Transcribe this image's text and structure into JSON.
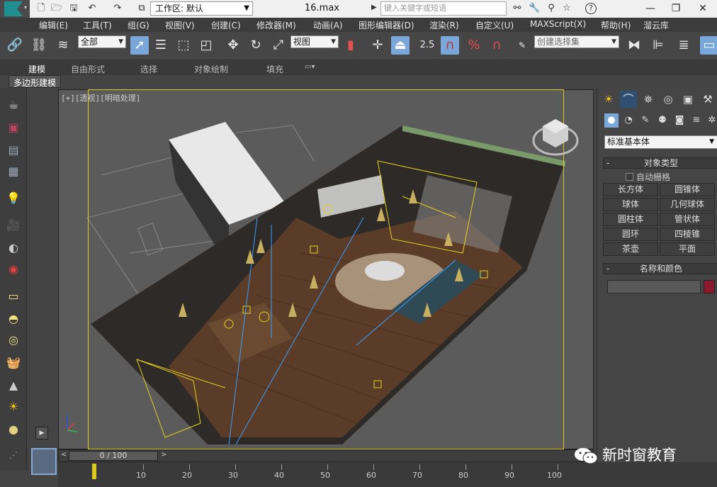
{
  "title_bar": {
    "workspace_label": "工作区: 默认",
    "file_name": "16.max",
    "search_placeholder": "键入关键字或短语"
  },
  "menu_bar": {
    "items": [
      "编辑(E)",
      "工具(T)",
      "组(G)",
      "视图(V)",
      "创建(C)",
      "修改器(M)",
      "动画(A)",
      "图形编辑器(D)",
      "渲染(R)",
      "自定义(U)",
      "MAXScript(X)",
      "帮助(H)",
      "溜云库"
    ]
  },
  "toolbar": {
    "selection_filter": "全部",
    "reference_coord": "视图",
    "snap_value": "2.5",
    "named_selection_placeholder": "创建选择集"
  },
  "ribbon": {
    "tabs": [
      "建模",
      "自由形式",
      "选择",
      "对象绘制",
      "填充"
    ],
    "active_subtab": "多边形建模"
  },
  "viewport": {
    "label": "[+][透视][明暗处理]"
  },
  "command_panel": {
    "category": "标准基本体",
    "object_type_header": "对象类型",
    "autogrid_label": "自动栅格",
    "object_buttons": [
      "长方体",
      "圆锥体",
      "球体",
      "几何球体",
      "圆柱体",
      "管状体",
      "圆环",
      "四棱锥",
      "茶壶",
      "平面"
    ],
    "name_color_header": "名称和颜色",
    "object_color": "#8a1a2c"
  },
  "time_slider": {
    "frame_display": "0 / 100",
    "ticks": [
      "10",
      "20",
      "30",
      "40",
      "50",
      "60",
      "70",
      "80",
      "90",
      "100"
    ]
  },
  "watermark": {
    "text": "新时窗教育"
  },
  "colors": {
    "selection_highlight": "#d8c820",
    "active_tool": "#7aa7d9",
    "ui_background": "#444444"
  }
}
